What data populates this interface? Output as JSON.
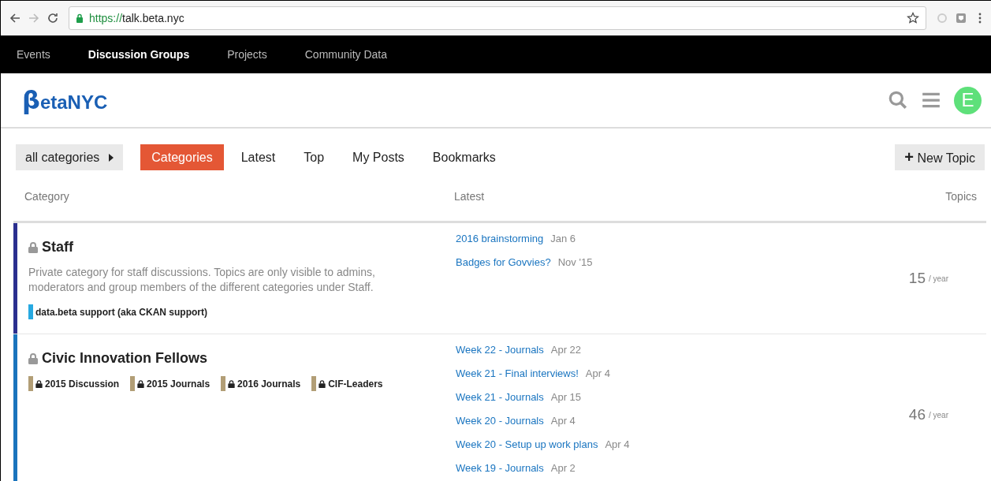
{
  "browser": {
    "url_scheme": "https://",
    "url_host": "talk.beta.nyc"
  },
  "top_nav": [
    {
      "label": "Events",
      "selected": false
    },
    {
      "label": "Discussion Groups",
      "selected": true
    },
    {
      "label": "Projects",
      "selected": false
    },
    {
      "label": "Community Data",
      "selected": false
    }
  ],
  "header": {
    "logo_mark": "β",
    "logo_text": "etaNYC",
    "avatar_letter": "E"
  },
  "category_dropdown": {
    "label": "all categories"
  },
  "tabs": [
    {
      "label": "Categories",
      "selected": true
    },
    {
      "label": "Latest",
      "selected": false
    },
    {
      "label": "Top",
      "selected": false
    },
    {
      "label": "My Posts",
      "selected": false
    },
    {
      "label": "Bookmarks",
      "selected": false
    }
  ],
  "new_topic_button": {
    "icon": "+",
    "label": "New Topic"
  },
  "table": {
    "columns": [
      "Category",
      "Latest",
      "Topics"
    ],
    "rows": [
      {
        "name": "Staff",
        "locked": true,
        "color": "#2b2f8f",
        "description": "Private category for staff discussions. Topics are only visible to admins, moderators and group members of the different categories under Staff.",
        "subcategories": [
          {
            "name": "data.beta support (aka CKAN support)",
            "locked": false,
            "color": "#27a9e1"
          }
        ],
        "latest": [
          {
            "title": "2016 brainstorming",
            "date": "Jan 6"
          },
          {
            "title": "Badges for Govvies?",
            "date": "Nov '15"
          }
        ],
        "topics": "15",
        "period": "/ year"
      },
      {
        "name": "Civic Innovation Fellows",
        "locked": true,
        "color": "#1a74bd",
        "subcategories": [
          {
            "name": "2015 Discussion",
            "locked": true,
            "color": "#b29e76"
          },
          {
            "name": "2015 Journals",
            "locked": true,
            "color": "#b29e76"
          },
          {
            "name": "2016 Journals",
            "locked": true,
            "color": "#b29e76"
          },
          {
            "name": "CIF-Leaders",
            "locked": true,
            "color": "#b29e76"
          }
        ],
        "latest": [
          {
            "title": "Week 22 - Journals",
            "date": "Apr 22"
          },
          {
            "title": "Week 21 - Final interviews!",
            "date": "Apr 4"
          },
          {
            "title": "Week 21 - Journals",
            "date": "Apr 15"
          },
          {
            "title": "Week 20 - Journals",
            "date": "Apr 4"
          },
          {
            "title": "Week 20 - Setup up work plans",
            "date": "Apr 4"
          },
          {
            "title": "Week 19 - Journals",
            "date": "Apr 2"
          }
        ],
        "topics": "46",
        "period": "/ year"
      }
    ]
  }
}
